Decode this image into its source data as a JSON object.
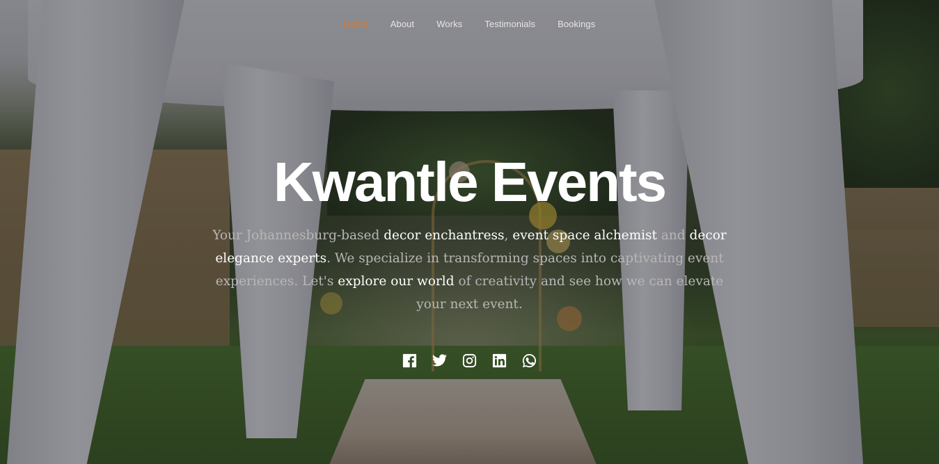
{
  "nav": {
    "items": [
      {
        "label": "Home",
        "active": true
      },
      {
        "label": "About",
        "active": false
      },
      {
        "label": "Works",
        "active": false
      },
      {
        "label": "Testimonials",
        "active": false
      },
      {
        "label": "Bookings",
        "active": false
      }
    ]
  },
  "hero": {
    "title": "Kwantle Events",
    "tagline": {
      "t1": "Your Johannesburg-based ",
      "h1": "decor enchantress",
      "t2": ", ",
      "h2": "event space alchemist",
      "t3": " and ",
      "h3": "decor elegance experts",
      "t4": ". We specialize in transforming spaces into captivating event experiences. Let's ",
      "h4": "explore our world",
      "t5": " of creativity and see how we can elevate your next event."
    }
  },
  "socials": [
    {
      "icon": "facebook-icon"
    },
    {
      "icon": "twitter-icon"
    },
    {
      "icon": "instagram-icon"
    },
    {
      "icon": "linkedin-icon"
    },
    {
      "icon": "whatsapp-icon"
    }
  ],
  "colors": {
    "accent": "#d97a2c",
    "text": "#ffffff",
    "muted": "#b7b7b7"
  }
}
